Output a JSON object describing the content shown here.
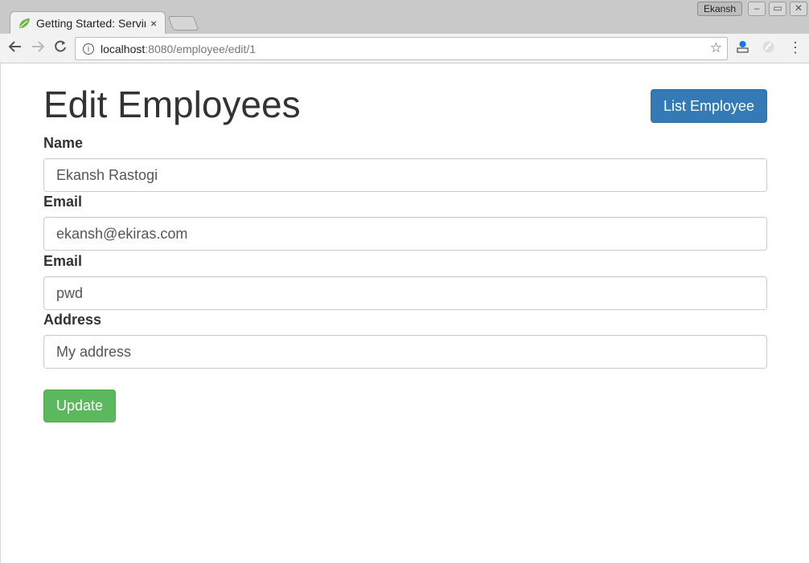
{
  "browser": {
    "tab_title": "Getting Started: Serving Web Content",
    "tab_close": "×",
    "profile_name": "Ekansh",
    "url_host": "localhost",
    "url_path": ":8080/employee/edit/1",
    "icons": {
      "back": "back-arrow-icon",
      "forward": "forward-arrow-icon",
      "reload": "reload-icon",
      "info": "info-icon",
      "star": "bookmark-star-icon",
      "menu": "more-vert-icon"
    }
  },
  "page": {
    "title": "Edit Employees",
    "list_button": "List Employee",
    "update_button": "Update",
    "fields": [
      {
        "label": "Name",
        "value": "Ekansh Rastogi"
      },
      {
        "label": "Email",
        "value": "ekansh@ekiras.com"
      },
      {
        "label": "Email",
        "value": "pwd"
      },
      {
        "label": "Address",
        "value": "My address"
      }
    ]
  },
  "colors": {
    "primary": "#337ab7",
    "success": "#5cb85c",
    "text": "#333333"
  }
}
